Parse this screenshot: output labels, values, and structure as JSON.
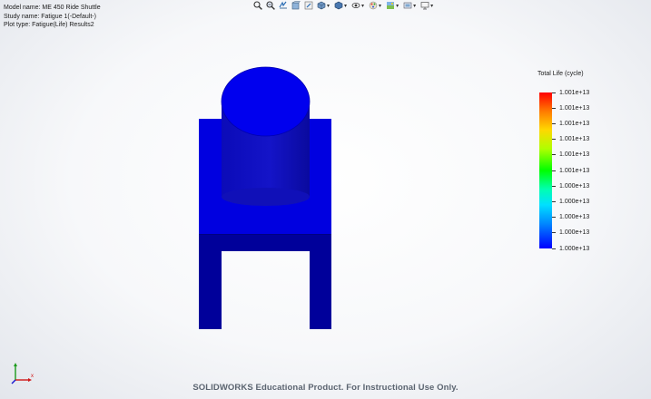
{
  "info": {
    "model_name": "Model name: ME 450 Ride Shuttle",
    "study_name": "Study name: Fatigue 1(-Default-)",
    "plot_type": "Plot type: Fatigue(Life) Results2"
  },
  "toolbar": {
    "icons": [
      "zoom-to-fit-icon",
      "zoom-to-area-icon",
      "previous-view-icon",
      "section-view-icon",
      "dynamic-annotation-icon",
      "view-orientation-icon",
      "display-style-icon",
      "hide-show-items-icon",
      "edit-appearance-icon",
      "apply-scene-icon",
      "view-settings-icon",
      "display-monitor-icon"
    ]
  },
  "legend": {
    "title": "Total Life (cycle)",
    "labels": [
      "1.001e+13",
      "1.001e+13",
      "1.001e+13",
      "1.001e+13",
      "1.001e+13",
      "1.001e+13",
      "1.000e+13",
      "1.000e+13",
      "1.000e+13",
      "1.000e+13",
      "1.000e+13"
    ],
    "colors": [
      "#ff0000",
      "#0000ff"
    ]
  },
  "watermark": "SOLIDWORKS Educational Product. For Instructional Use Only.",
  "model_color": "#0000e6"
}
